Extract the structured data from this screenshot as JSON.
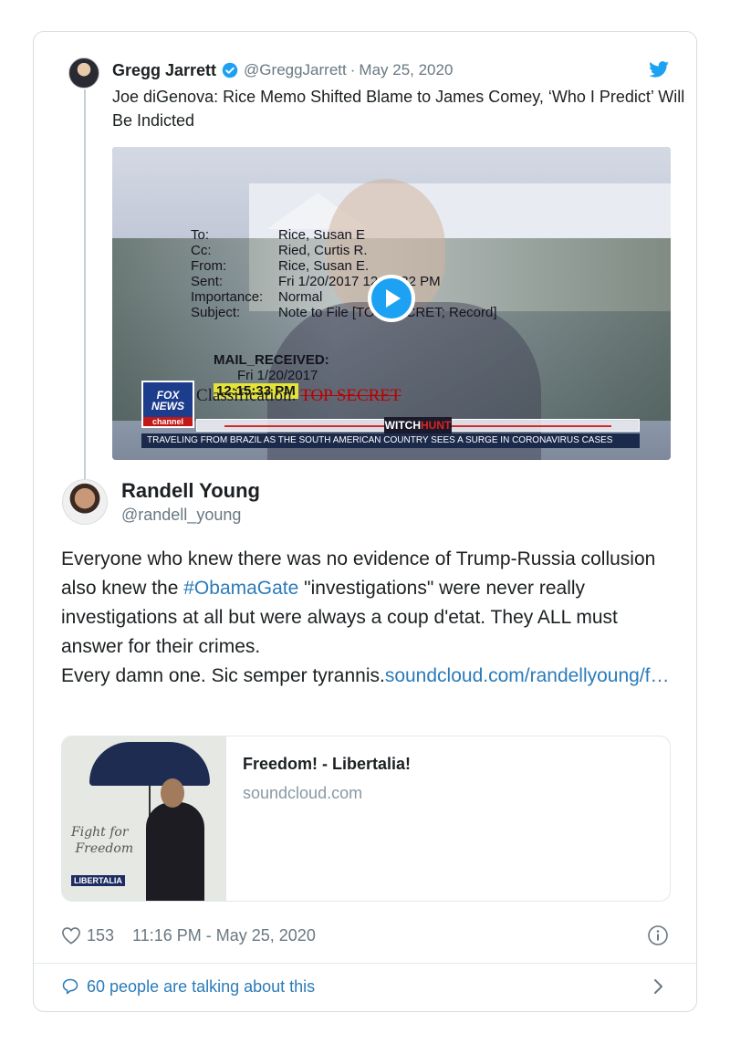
{
  "quoted_tweet": {
    "name": "Gregg Jarrett",
    "handle": "@GreggJarrett",
    "separator": "·",
    "date": "May 25, 2020",
    "text": "Joe diGenova: Rice Memo Shifted Blame to James Comey, ‘Who I Predict’ Will Be Indicted",
    "video": {
      "memo_labels": "To:\nCc:\nFrom:\nSent:\nImportance:\nSubject:",
      "memo_values": "Rice, Susan E\nRied, Curtis R.\nRice, Susan E.\nFri 1/20/2017 12:15:32 PM\nNormal\nNote to File [TOP SECRET; Record]",
      "mail_received_label": "MAIL_RECEIVED:",
      "mail_received_date": "Fri 1/20/2017",
      "mail_received_time": "12:15:33 PM",
      "classification_label": "Classification:",
      "classification_value": "TOP SECRET",
      "network": "FOX NEWS",
      "network_sub": "channel",
      "ticker_tag_prefix": "WITCH",
      "ticker_tag_suffix": "HUNT",
      "ticker": "TRAVELING FROM BRAZIL AS THE SOUTH AMERICAN COUNTRY SEES A SURGE IN CORONAVIRUS CASES"
    }
  },
  "tweet": {
    "name": "Randell Young",
    "handle": "@randell_young",
    "text_part1": "Everyone who knew there was no evidence of Trump-Russia collusion also knew the ",
    "hashtag": "#ObamaGate",
    "text_part2": " \"investigations\" were never really investigations at all but were always a coup d'etat. They ALL must answer for their crimes.",
    "text_part3": "Every damn one. Sic semper tyrannis.",
    "link": "soundcloud.com/randellyoung/f…"
  },
  "link_card": {
    "title": "Freedom! - Libertalia!",
    "domain": "soundcloud.com",
    "image_text": "Fight for\n Freedom",
    "image_badge": "LIBERTALIA"
  },
  "footer": {
    "likes": "153",
    "timestamp": "11:16 PM - May 25, 2020",
    "talking": "60 people are talking about this"
  },
  "colors": {
    "link": "#2b7bb9",
    "twitter_blue": "#1da1f2",
    "muted": "#697882"
  }
}
